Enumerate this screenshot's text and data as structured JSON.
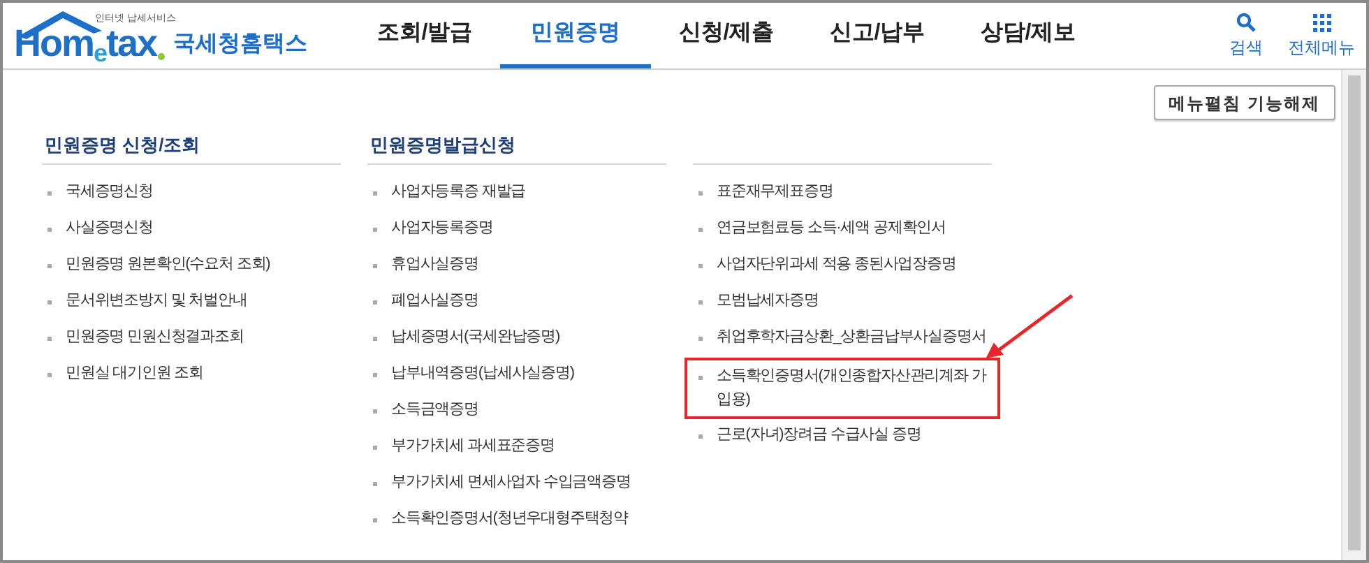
{
  "logo": {
    "tagline": "인터넷 납세서비스",
    "wordmark_start": "Hom",
    "wordmark_e": "e",
    "wordmark_end": "tax",
    "name": "국세청홈택스"
  },
  "nav": [
    {
      "label": "조회/발급",
      "selected": false
    },
    {
      "label": "민원증명",
      "selected": true
    },
    {
      "label": "신청/제출",
      "selected": false
    },
    {
      "label": "신고/납부",
      "selected": false
    },
    {
      "label": "상담/제보",
      "selected": false
    }
  ],
  "tools": [
    {
      "kind": "search",
      "label": "검색"
    },
    {
      "kind": "menu",
      "label": "전체메뉴"
    }
  ],
  "menu_toggle_button": "메뉴펼침 기능해제",
  "columns": [
    {
      "heading": "민원증명 신청/조회",
      "items": [
        {
          "label": "국세증명신청",
          "highlighted": false
        },
        {
          "label": "사실증명신청",
          "highlighted": false
        },
        {
          "label": "민원증명 원본확인(수요처 조회)",
          "highlighted": false
        },
        {
          "label": "문서위변조방지 및 처벌안내",
          "highlighted": false
        },
        {
          "label": "민원증명 민원신청결과조회",
          "highlighted": false
        },
        {
          "label": "민원실 대기인원 조회",
          "highlighted": false
        }
      ]
    },
    {
      "heading": "민원증명발급신청",
      "items": [
        {
          "label": "사업자등록증 재발급",
          "highlighted": false
        },
        {
          "label": "사업자등록증명",
          "highlighted": false
        },
        {
          "label": "휴업사실증명",
          "highlighted": false
        },
        {
          "label": "폐업사실증명",
          "highlighted": false
        },
        {
          "label": "납세증명서(국세완납증명)",
          "highlighted": false
        },
        {
          "label": "납부내역증명(납세사실증명)",
          "highlighted": false
        },
        {
          "label": "소득금액증명",
          "highlighted": false
        },
        {
          "label": "부가가치세 과세표준증명",
          "highlighted": false
        },
        {
          "label": "부가가치세 면세사업자 수입금액증명",
          "highlighted": false
        },
        {
          "label": "소득확인증명서(청년우대형주택청약",
          "highlighted": false
        }
      ]
    },
    {
      "items": [
        {
          "label": "표준재무제표증명",
          "highlighted": false
        },
        {
          "label": "연금보험료등 소득·세액 공제확인서",
          "highlighted": false
        },
        {
          "label": "사업자단위과세 적용 종된사업장증명",
          "highlighted": false
        },
        {
          "label": "모범납세자증명",
          "highlighted": false
        },
        {
          "label": "취업후학자금상환_상환금납부사실증명서",
          "highlighted": false
        },
        {
          "label": "소득확인증명서(개인종합자산관리계좌 가입용)",
          "highlighted": true
        },
        {
          "label": "근로(자녀)장려금 수급사실 증명",
          "highlighted": false
        }
      ]
    }
  ]
}
